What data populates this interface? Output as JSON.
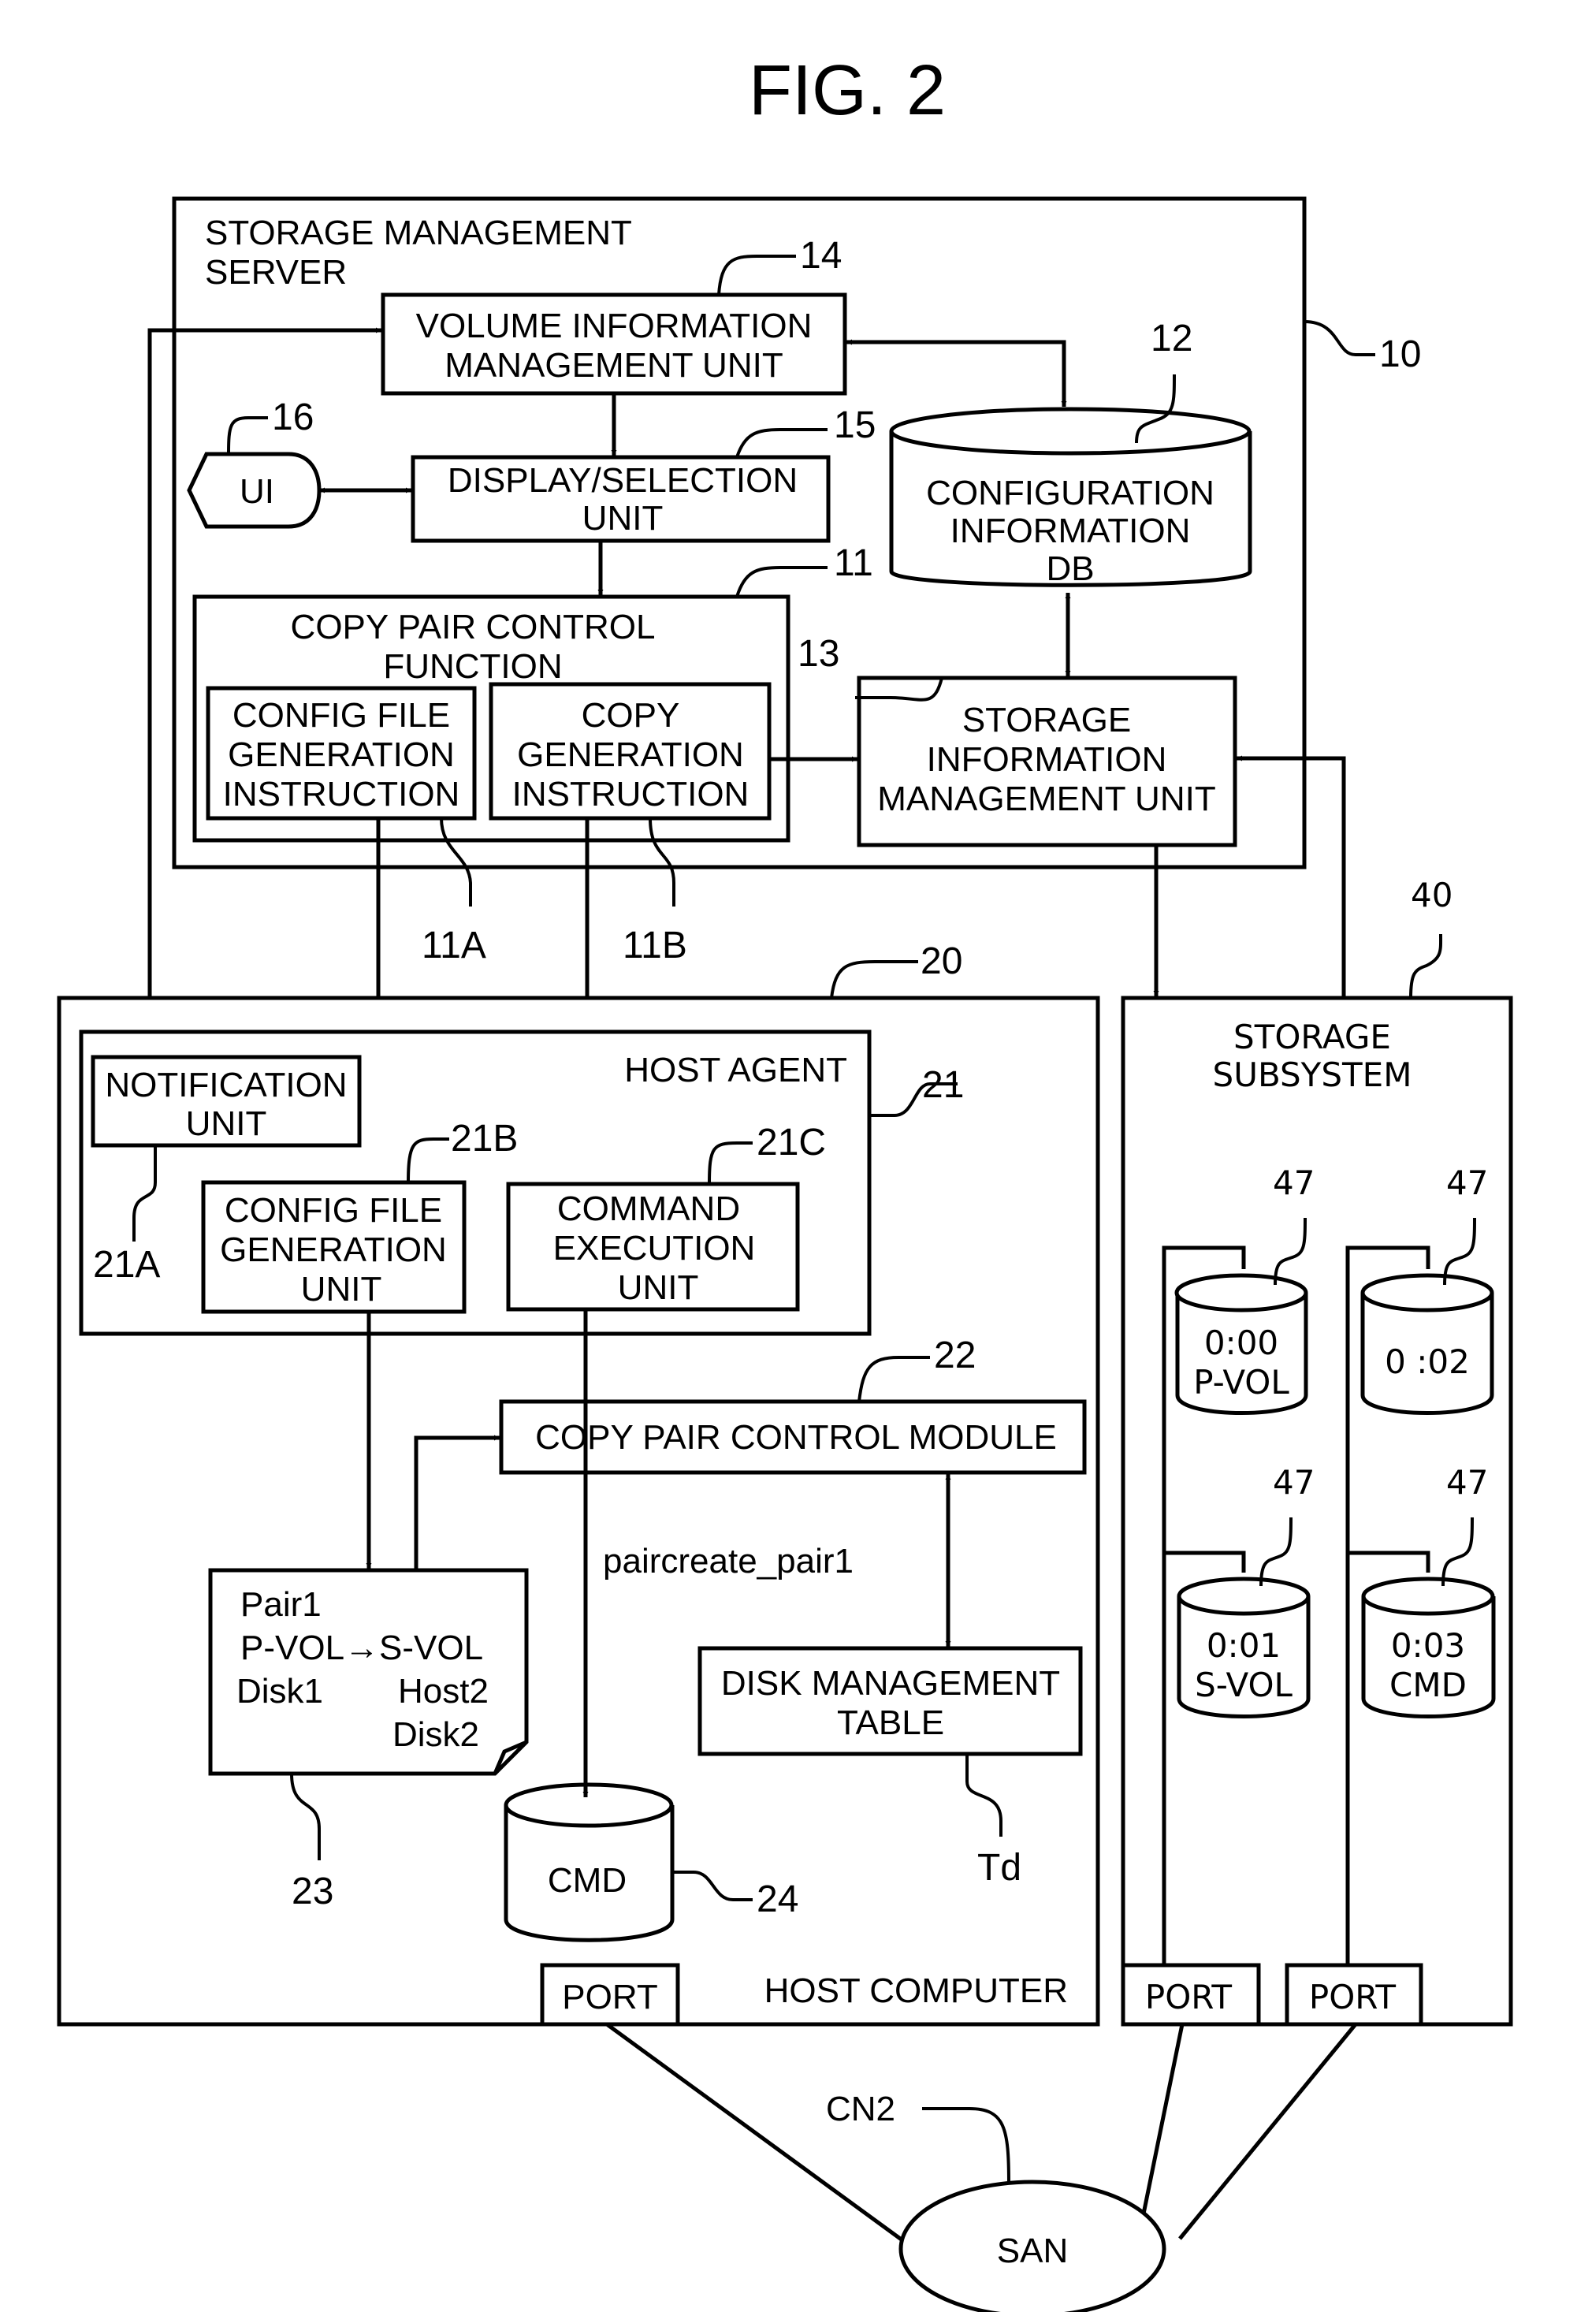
{
  "figure": {
    "title": "FIG. 2"
  },
  "storage_management_server": {
    "label_line1": "STORAGE MANAGEMENT",
    "label_line2": "SERVER",
    "ref": "10",
    "volume_info_unit": {
      "line1": "VOLUME INFORMATION",
      "line2": "MANAGEMENT UNIT",
      "ref": "14"
    },
    "ui": {
      "label": "UI",
      "ref": "16"
    },
    "display_selection_unit": {
      "line1": "DISPLAY/SELECTION",
      "line2": "UNIT",
      "ref": "15"
    },
    "config_db": {
      "line1": "CONFIGURATION",
      "line2": "INFORMATION",
      "line3": "DB",
      "ref": "12"
    },
    "copy_pair_control_function": {
      "line1": "COPY PAIR CONTROL",
      "line2": "FUNCTION",
      "ref": "11",
      "config_file_instruction": {
        "line1": "CONFIG FILE",
        "line2": "GENERATION",
        "line3": "INSTRUCTION",
        "ref": "11A"
      },
      "copy_generation_instruction": {
        "line1": "COPY",
        "line2": "GENERATION",
        "line3": "INSTRUCTION",
        "ref": "11B"
      }
    },
    "storage_info_unit": {
      "line1": "STORAGE",
      "line2": "INFORMATION",
      "line3": "MANAGEMENT UNIT",
      "ref": "13"
    }
  },
  "host_computer": {
    "label": "HOST COMPUTER",
    "ref": "20",
    "host_agent": {
      "label": "HOST AGENT",
      "ref": "21",
      "notification_unit": {
        "line1": "NOTIFICATION",
        "line2": "UNIT",
        "ref": "21A"
      },
      "config_file_unit": {
        "line1": "CONFIG FILE",
        "line2": "GENERATION",
        "line3": "UNIT",
        "ref": "21B"
      },
      "command_execution_unit": {
        "line1": "COMMAND",
        "line2": "EXECUTION",
        "line3": "UNIT",
        "ref": "21C"
      }
    },
    "copy_pair_control_module": {
      "label": "COPY PAIR CONTROL MODULE",
      "ref": "22"
    },
    "command_label": "paircreate_pair1",
    "config_file": {
      "ref": "23",
      "line1": "Pair1",
      "line2": "P-VOL→S-VOL",
      "line3_left": "Disk1",
      "line3_right": "Host2",
      "line4": "Disk2"
    },
    "cmd_volume": {
      "label": "CMD",
      "ref": "24"
    },
    "disk_management_table": {
      "line1": "DISK MANAGEMENT",
      "line2": "TABLE",
      "ref": "Td"
    },
    "port": "PORT"
  },
  "storage_subsystem": {
    "line1": "STORAGE",
    "line2": "SUBSYSTEM",
    "ref": "40",
    "volumes": [
      {
        "id": "0:00",
        "role": "P-VOL",
        "ref": "47"
      },
      {
        "id": "0 :02",
        "role": "",
        "ref": "47"
      },
      {
        "id": "0:01",
        "role": "S-VOL",
        "ref": "47"
      },
      {
        "id": "0:03",
        "role": "CMD",
        "ref": "47"
      }
    ],
    "ports": [
      "PORT",
      "PORT"
    ]
  },
  "network": {
    "label": "SAN",
    "ref": "CN2"
  }
}
